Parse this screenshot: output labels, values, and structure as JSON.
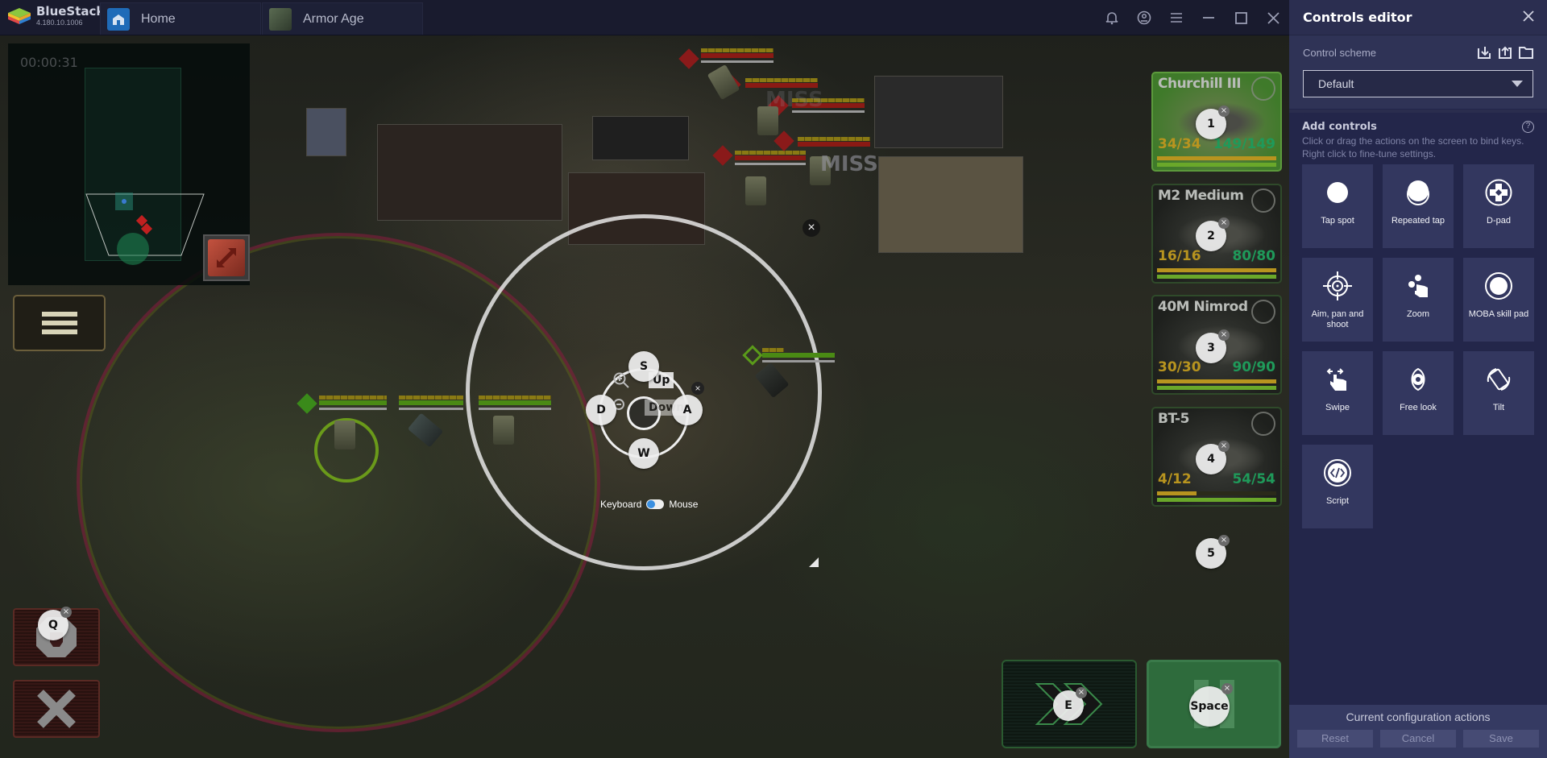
{
  "titlebar": {
    "brand": "BlueStacks",
    "version": "4.180.10.1006",
    "tabs": [
      {
        "label": "Home",
        "icon": "home-icon"
      },
      {
        "label": "Armor Age",
        "icon": "game-thumbnail-icon"
      }
    ],
    "window_icons": [
      "bell-icon",
      "account-icon",
      "menu-icon",
      "minimize-icon",
      "maximize-icon",
      "close-icon"
    ]
  },
  "game": {
    "timer": "00:00:31",
    "miss_labels": [
      "MISS",
      "MISS"
    ],
    "units": [
      {
        "name": "Churchill III",
        "ammo": "34/34",
        "hp": "149/149",
        "ammo_fraction": 1.0,
        "hp_fraction": 1.0,
        "active": true,
        "key": "1"
      },
      {
        "name": "M2 Medium",
        "ammo": "16/16",
        "hp": "80/80",
        "ammo_fraction": 1.0,
        "hp_fraction": 1.0,
        "active": false,
        "key": "2"
      },
      {
        "name": "40M Nimrod",
        "ammo": "30/30",
        "hp": "90/90",
        "ammo_fraction": 1.0,
        "hp_fraction": 1.0,
        "active": false,
        "key": "3"
      },
      {
        "name": "BT-5",
        "ammo": "4/12",
        "hp": "54/54",
        "ammo_fraction": 0.33,
        "hp_fraction": 1.0,
        "active": false,
        "key": "4"
      }
    ],
    "extra_key": "5",
    "left_keys": {
      "ability": "Q"
    },
    "bottom_keys": {
      "fast_forward": "E",
      "pause": "Space"
    },
    "dpad": {
      "up": "S",
      "down": "W",
      "left": "D",
      "right": "A",
      "zoom_up": "Up",
      "zoom_down": "Down",
      "toggle_left": "Keyboard",
      "toggle_right": "Mouse"
    },
    "close_glyph": "×"
  },
  "panel": {
    "title": "Controls editor",
    "scheme_label": "Control scheme",
    "scheme_icons": [
      "import-icon",
      "export-icon",
      "folder-icon"
    ],
    "scheme_value": "Default",
    "add_title": "Add controls",
    "add_desc_1": "Click or drag the actions on the screen to bind keys.",
    "add_desc_2": "Right click to fine-tune settings.",
    "controls": [
      {
        "label": "Tap spot",
        "icon": "tap-spot-icon"
      },
      {
        "label": "Repeated tap",
        "icon": "repeated-tap-icon"
      },
      {
        "label": "D-pad",
        "icon": "dpad-icon"
      },
      {
        "label": "Aim, pan and shoot",
        "icon": "crosshair-icon"
      },
      {
        "label": "Zoom",
        "icon": "zoom-gesture-icon"
      },
      {
        "label": "MOBA skill pad",
        "icon": "moba-skill-icon"
      },
      {
        "label": "Swipe",
        "icon": "swipe-icon"
      },
      {
        "label": "Free look",
        "icon": "free-look-icon"
      },
      {
        "label": "Tilt",
        "icon": "tilt-icon"
      },
      {
        "label": "Script",
        "icon": "script-icon"
      }
    ],
    "footer_label": "Current configuration actions",
    "footer_buttons": {
      "reset": "Reset",
      "cancel": "Cancel",
      "save": "Save"
    }
  }
}
